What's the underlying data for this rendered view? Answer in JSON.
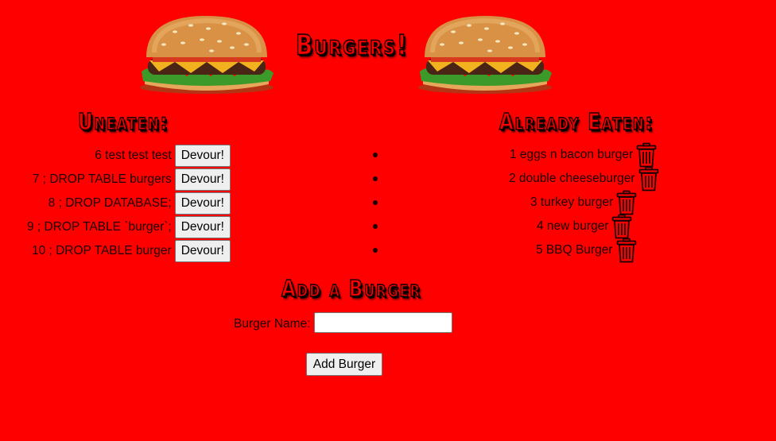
{
  "header": {
    "title": "Burgers!",
    "left_image": "burger-image",
    "right_image": "burger-image"
  },
  "uneaten": {
    "heading": "Uneaten:",
    "button_label": "Devour!",
    "items": [
      {
        "text": "6 test test test"
      },
      {
        "text": "7 ; DROP TABLE burgers"
      },
      {
        "text": "8 ; DROP DATABASE;"
      },
      {
        "text": "9 ; DROP TABLE `burger`;"
      },
      {
        "text": "10 ; DROP TABLE burger"
      }
    ]
  },
  "eaten": {
    "heading": "Already Eaten:",
    "delete_icon": "trash-icon",
    "items": [
      {
        "text": "1 eggs n bacon burger"
      },
      {
        "text": "2 double cheeseburger"
      },
      {
        "text": "3 turkey burger"
      },
      {
        "text": "4 new burger"
      },
      {
        "text": "5 BBQ Burger"
      }
    ]
  },
  "form": {
    "heading": "Add a Burger",
    "name_label": "Burger Name:",
    "name_value": "",
    "submit_label": "Add Burger"
  },
  "colors": {
    "background": "#ff0000",
    "text": "#1a0000"
  }
}
